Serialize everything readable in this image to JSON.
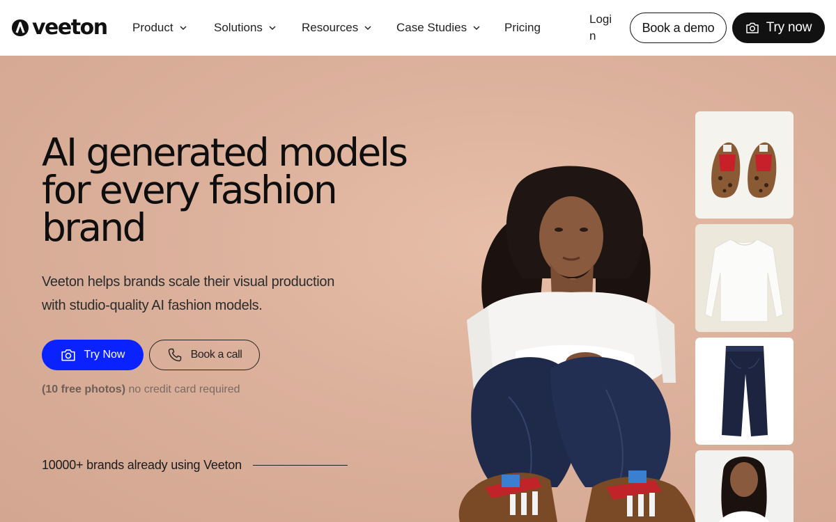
{
  "nav": {
    "logo_text": "veeton",
    "items": [
      {
        "label": "Product",
        "has_dropdown": true
      },
      {
        "label": "Solutions",
        "has_dropdown": true
      },
      {
        "label": "Resources",
        "has_dropdown": true
      },
      {
        "label": "Case Studies",
        "has_dropdown": true
      },
      {
        "label": "Pricing",
        "has_dropdown": false
      }
    ],
    "login_label": "Login",
    "book_demo_label": "Book a demo",
    "try_now_label": "Try now",
    "try_now_icon": "camera-icon"
  },
  "hero": {
    "title": "AI generated models for every fashion brand",
    "subtitle": "Veeton helps brands scale their visual production with studio-quality AI fashion models.",
    "try_now_label": "Try Now",
    "try_now_icon": "camera-icon",
    "book_call_label": "Book a call",
    "book_call_icon": "phone-icon",
    "free_bold": "(10 free photos)",
    "free_text": " no credit card required",
    "brands_text": "10000+ brands already using Veeton"
  },
  "products": [
    {
      "name": "leopard-sneakers"
    },
    {
      "name": "white-longsleeve"
    },
    {
      "name": "dark-denim-jeans"
    },
    {
      "name": "model-portrait"
    }
  ],
  "colors": {
    "primary_blue": "#0a22ff",
    "dark": "#111111",
    "hero_bg": "#dcb19c"
  }
}
